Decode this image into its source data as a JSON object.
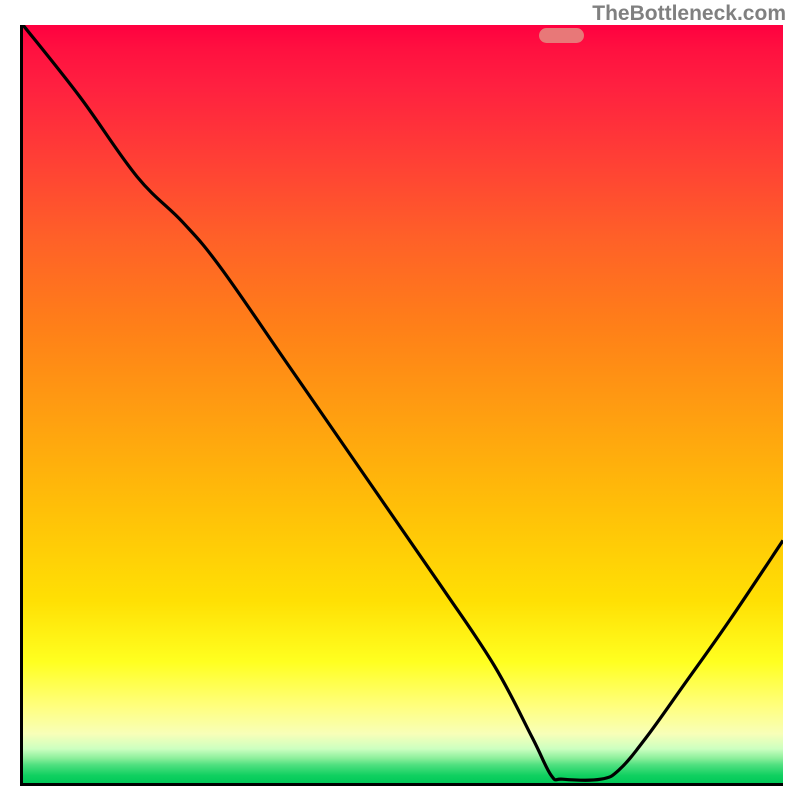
{
  "attribution": "TheBottleneck.com",
  "marker": {
    "x_frac": 0.708,
    "y_frac": 0.986
  },
  "chart_data": {
    "type": "line",
    "title": "",
    "xlabel": "",
    "ylabel": "",
    "xlim": [
      0,
      1
    ],
    "ylim": [
      0,
      1
    ],
    "series": [
      {
        "name": "curve",
        "points": [
          {
            "x": 0.0,
            "y": 1.0
          },
          {
            "x": 0.075,
            "y": 0.905
          },
          {
            "x": 0.15,
            "y": 0.8
          },
          {
            "x": 0.21,
            "y": 0.74
          },
          {
            "x": 0.26,
            "y": 0.68
          },
          {
            "x": 0.35,
            "y": 0.55
          },
          {
            "x": 0.45,
            "y": 0.405
          },
          {
            "x": 0.55,
            "y": 0.26
          },
          {
            "x": 0.62,
            "y": 0.155
          },
          {
            "x": 0.67,
            "y": 0.06
          },
          {
            "x": 0.695,
            "y": 0.01
          },
          {
            "x": 0.71,
            "y": 0.005
          },
          {
            "x": 0.76,
            "y": 0.005
          },
          {
            "x": 0.785,
            "y": 0.018
          },
          {
            "x": 0.82,
            "y": 0.06
          },
          {
            "x": 0.87,
            "y": 0.13
          },
          {
            "x": 0.93,
            "y": 0.215
          },
          {
            "x": 1.0,
            "y": 0.32
          }
        ]
      }
    ],
    "gradient_stops": [
      {
        "pos": 0.0,
        "color": "#ff0040"
      },
      {
        "pos": 0.5,
        "color": "#ffa010"
      },
      {
        "pos": 0.85,
        "color": "#ffff40"
      },
      {
        "pos": 1.0,
        "color": "#00c858"
      }
    ]
  }
}
